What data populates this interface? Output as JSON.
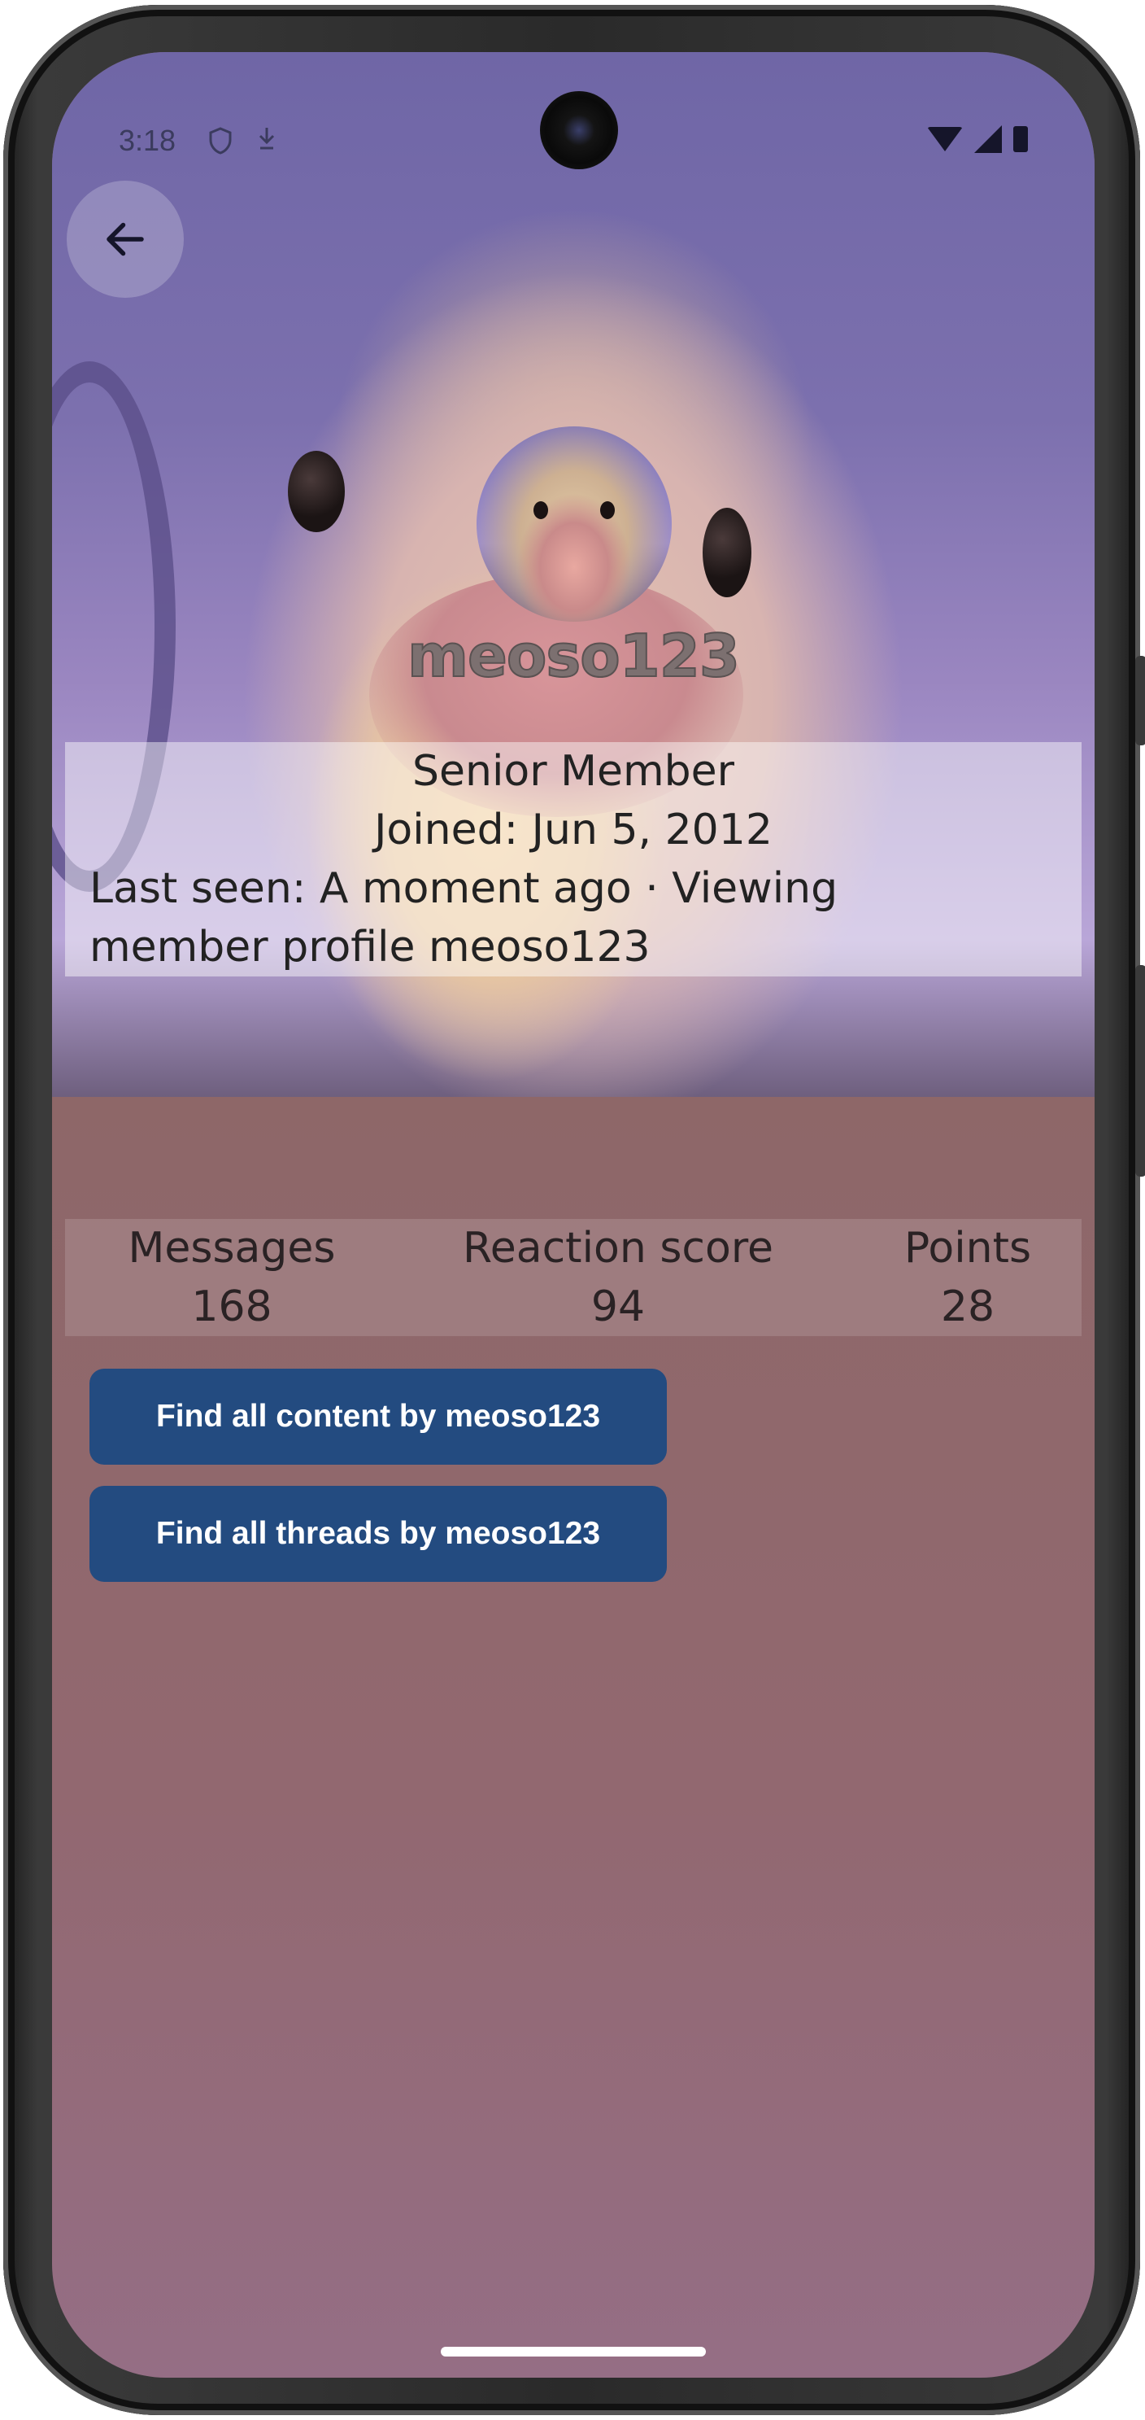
{
  "status_bar": {
    "time": "3:18"
  },
  "profile": {
    "username": "meoso123",
    "title": "Senior Member",
    "joined": "Joined: Jun 5, 2012",
    "last_seen": "Last seen: A moment ago · Viewing member profile meoso123"
  },
  "stats": [
    {
      "label": "Messages",
      "value": "168"
    },
    {
      "label": "Reaction score",
      "value": "94"
    },
    {
      "label": "Points",
      "value": "28"
    }
  ],
  "actions": {
    "find_content": "Find all content by meoso123",
    "find_threads": "Find all threads by meoso123"
  },
  "icons": {
    "back": "arrow-left-icon",
    "shield": "shield-icon",
    "download": "download-icon",
    "wifi": "wifi-icon",
    "signal": "signal-icon",
    "battery": "battery-icon"
  },
  "colors": {
    "button_bg": "#234b80",
    "button_text": "#ffffff",
    "page_bg": "#8d6767"
  }
}
